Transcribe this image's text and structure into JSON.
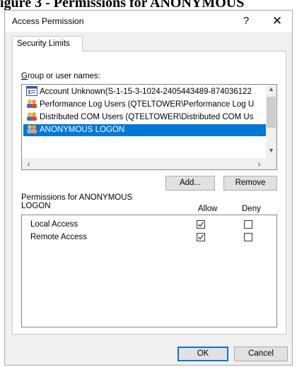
{
  "document": {
    "caption": "igure 3 - Permissions for ANONYMOUS"
  },
  "window": {
    "title": "Access Permission",
    "help_glyph": "?",
    "close_glyph": "✕"
  },
  "tabs": [
    {
      "label": "Security Limits",
      "selected": true
    }
  ],
  "group_list": {
    "label": "Group or user names:",
    "items": [
      {
        "text": "Account Unknown(S-1-15-3-1024-2405443489-874036122",
        "icon": "unknown-account-icon",
        "selected": false
      },
      {
        "text": "Performance Log Users (QTELTOWER\\Performance Log U",
        "icon": "users-group-icon",
        "selected": false
      },
      {
        "text": "Distributed COM Users (QTELTOWER\\Distributed COM Us",
        "icon": "users-group-icon",
        "selected": false
      },
      {
        "text": "ANONYMOUS LOGON",
        "icon": "users-group-icon",
        "selected": true
      }
    ]
  },
  "buttons": {
    "add": "Add...",
    "remove": "Remove",
    "ok": "OK",
    "cancel": "Cancel"
  },
  "permissions": {
    "label": "Permissions for ANONYMOUS\nLOGON",
    "columns": {
      "allow": "Allow",
      "deny": "Deny"
    },
    "rows": [
      {
        "name": "Local Access",
        "allow": true,
        "deny": false
      },
      {
        "name": "Remote Access",
        "allow": true,
        "deny": false
      }
    ]
  },
  "colors": {
    "selection": "#0078d7",
    "dialog_bg": "#f0f0f0"
  }
}
